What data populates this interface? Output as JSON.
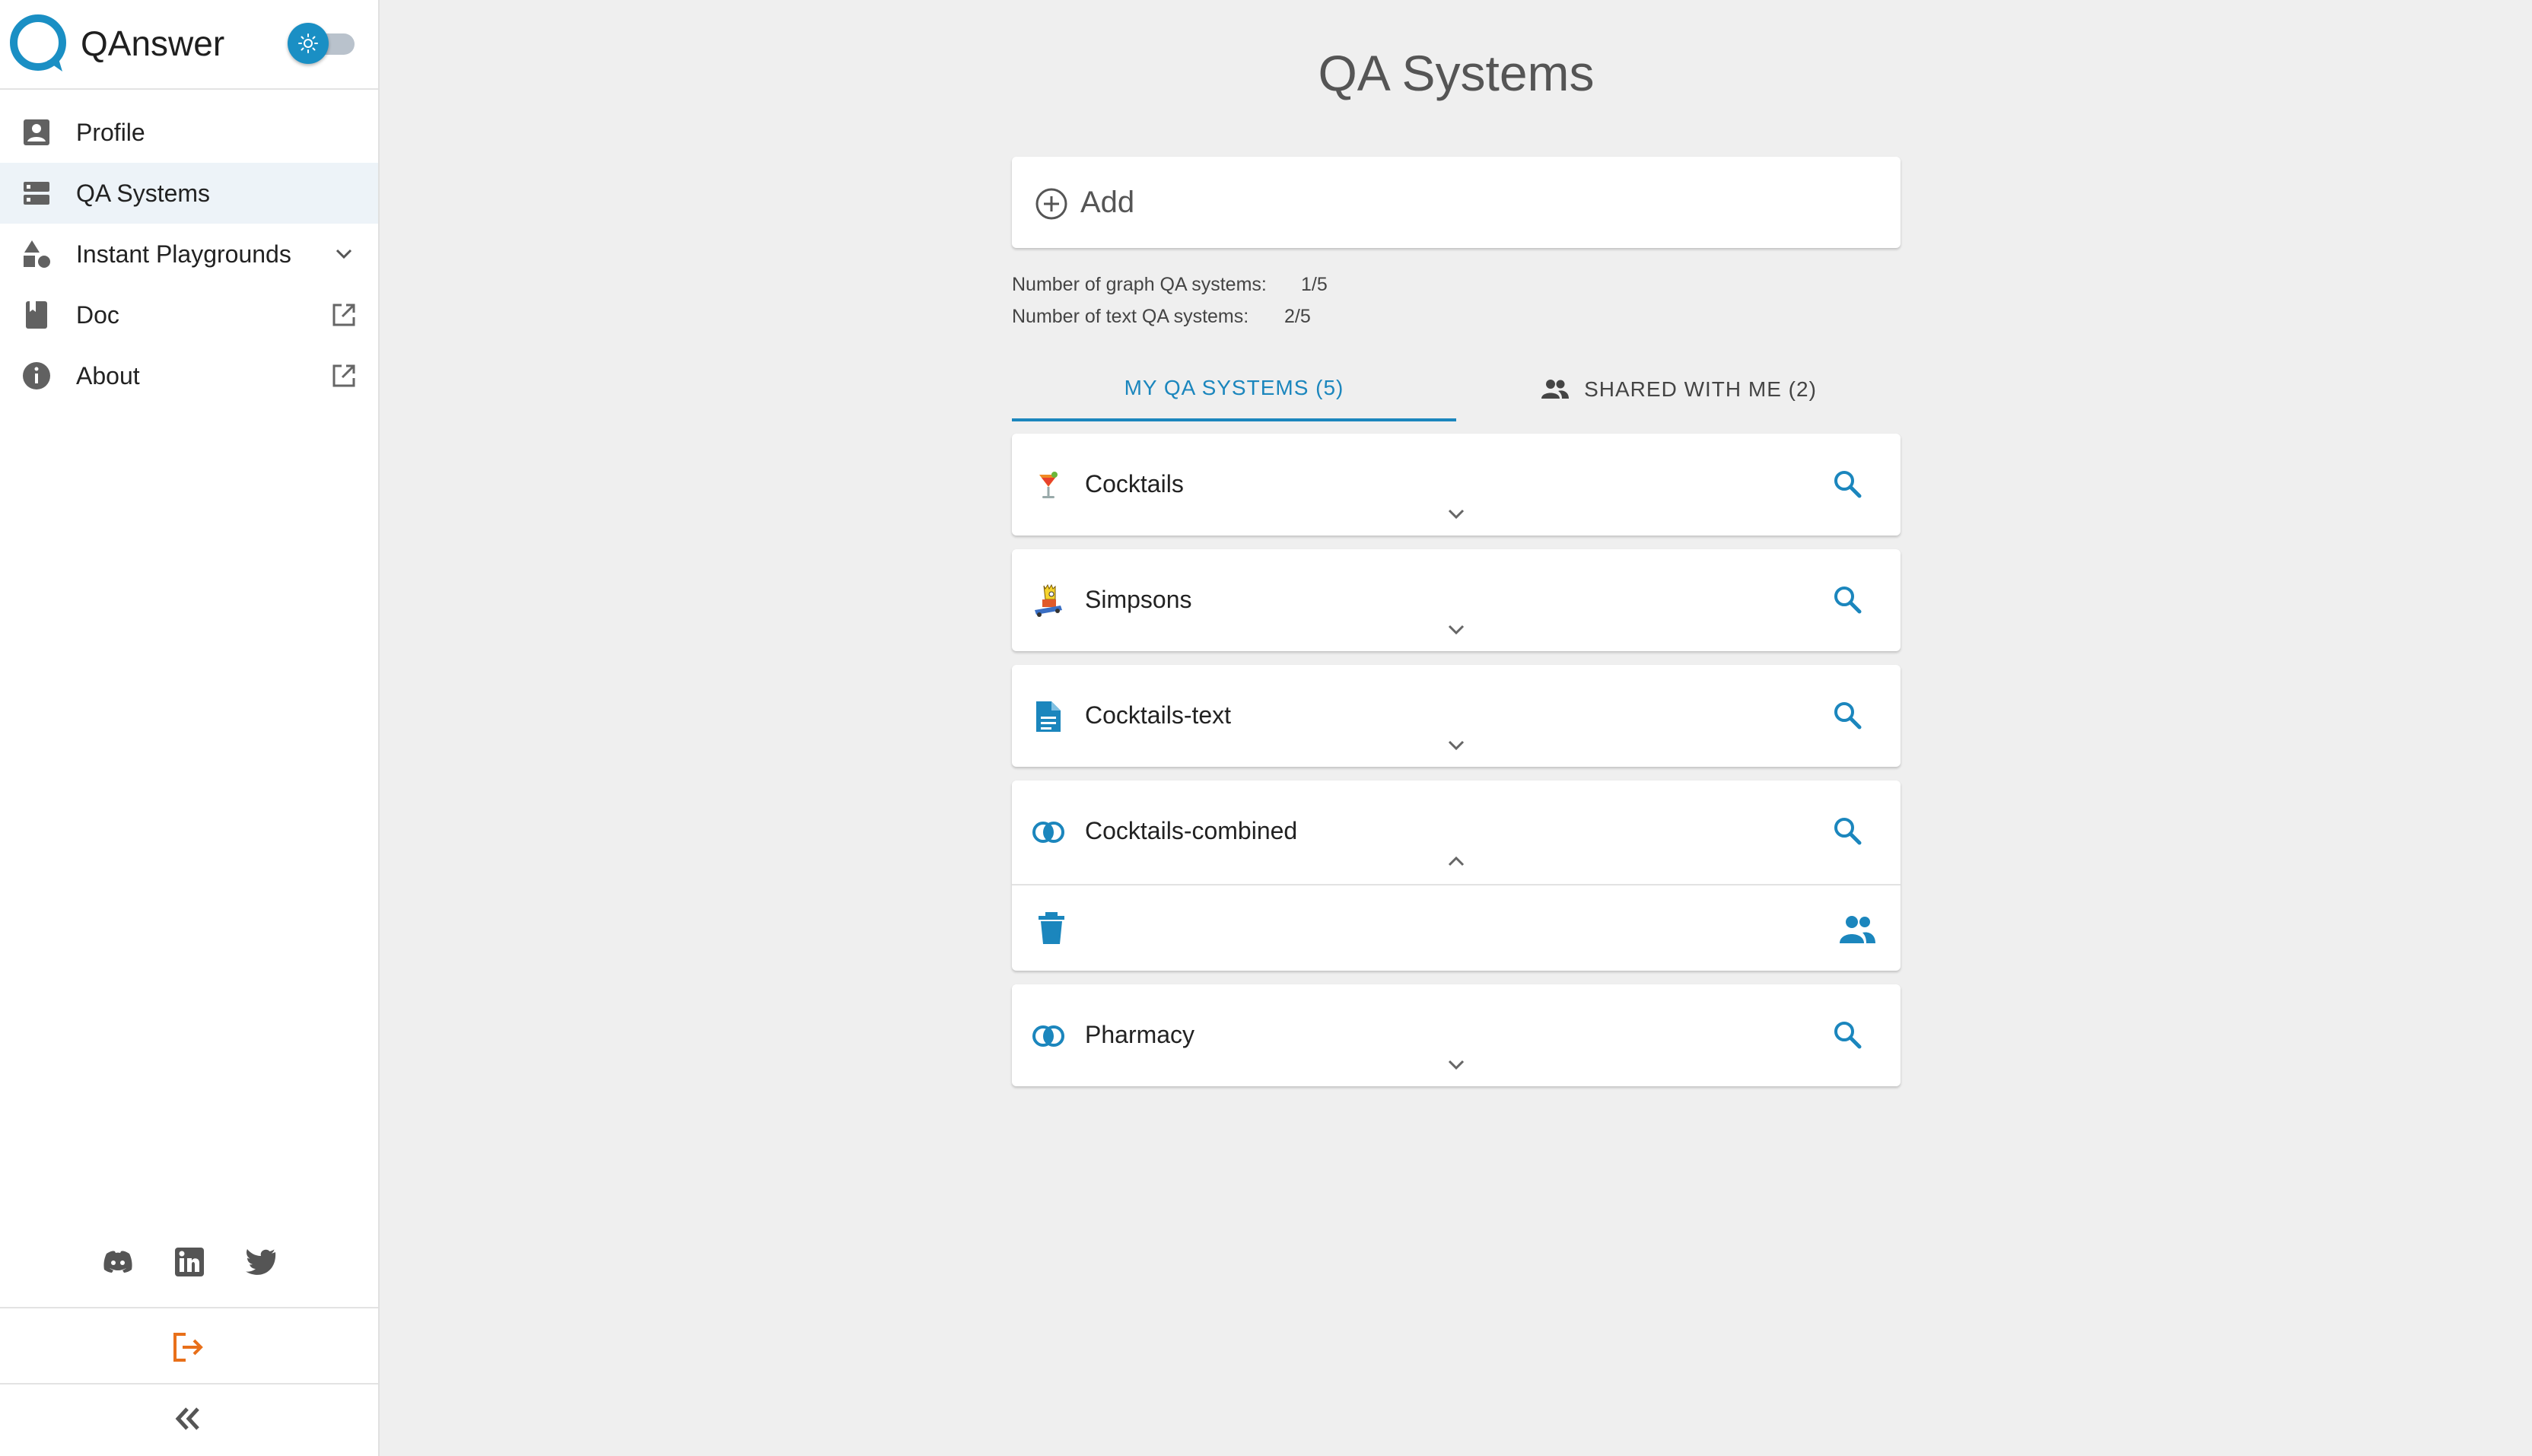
{
  "app": {
    "name": "QAnswer"
  },
  "sidebar": {
    "items": [
      {
        "label": "Profile",
        "icon": "person-badge-icon"
      },
      {
        "label": "QA Systems",
        "icon": "storage-icon"
      },
      {
        "label": "Instant Playgrounds",
        "icon": "shapes-icon"
      },
      {
        "label": "Doc",
        "icon": "book-icon"
      },
      {
        "label": "About",
        "icon": "info-icon"
      }
    ],
    "socials": [
      "discord-icon",
      "linkedin-icon",
      "twitter-icon"
    ]
  },
  "main": {
    "title": "QA Systems",
    "add_label": "Add",
    "stats": {
      "graph_label": "Number of graph QA systems:",
      "graph_value": "1/5",
      "text_label": "Number of text QA systems:",
      "text_value": "2/5"
    },
    "tabs": [
      {
        "label": "MY QA SYSTEMS (5)"
      },
      {
        "label": "SHARED WITH ME (2)"
      }
    ],
    "systems": [
      {
        "name": "Cocktails",
        "icon": "cocktail-icon"
      },
      {
        "name": "Simpsons",
        "icon": "simpsons-icon"
      },
      {
        "name": "Cocktails-text",
        "icon": "document-icon"
      },
      {
        "name": "Cocktails-combined",
        "icon": "combined-icon"
      },
      {
        "name": "Pharmacy",
        "icon": "combined-icon"
      }
    ]
  },
  "colors": {
    "accent": "#1b86bd",
    "logout": "#e8701a",
    "background": "#efefef"
  }
}
